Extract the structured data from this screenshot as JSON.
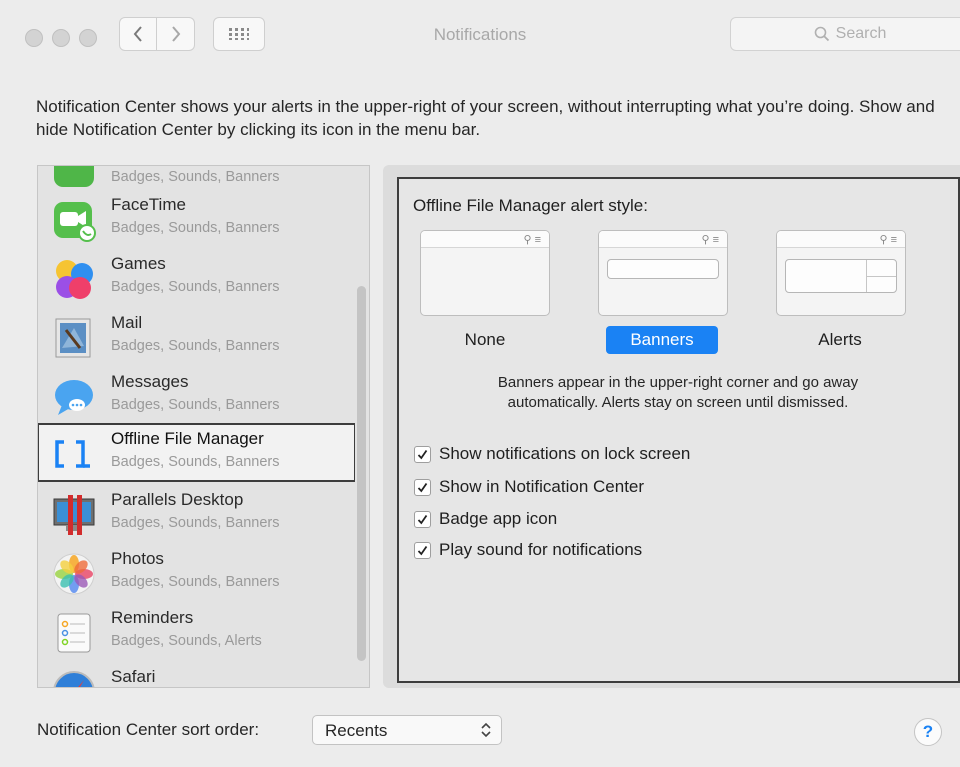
{
  "window": {
    "title": "Notifications"
  },
  "search": {
    "placeholder": "Search"
  },
  "intro": "Notification Center shows your alerts in the upper-right of your screen, without interrupting what you’re doing. Show and hide Notification Center by clicking its icon in the menu bar.",
  "app_list": [
    {
      "name": "",
      "status": "Badges, Sounds, Banners",
      "icon": "facetime-partial-icon"
    },
    {
      "name": "FaceTime",
      "status": "Badges, Sounds, Banners",
      "icon": "facetime-icon"
    },
    {
      "name": "Games",
      "status": "Badges, Sounds, Banners",
      "icon": "game-center-icon"
    },
    {
      "name": "Mail",
      "status": "Badges, Sounds, Banners",
      "icon": "mail-icon"
    },
    {
      "name": "Messages",
      "status": "Badges, Sounds, Banners",
      "icon": "messages-icon"
    },
    {
      "name": "Offline File Manager",
      "status": "Badges, Sounds, Banners",
      "icon": "offline-file-manager-icon",
      "selected": true
    },
    {
      "name": "Parallels Desktop",
      "status": "Badges, Sounds, Banners",
      "icon": "parallels-icon"
    },
    {
      "name": "Photos",
      "status": "Badges, Sounds, Banners",
      "icon": "photos-icon"
    },
    {
      "name": "Reminders",
      "status": "Badges, Sounds, Alerts",
      "icon": "reminders-icon"
    },
    {
      "name": "Safari",
      "status": "",
      "icon": "safari-icon"
    }
  ],
  "detail": {
    "alert_style_title": "Offline File Manager alert style:",
    "styles": [
      {
        "label": "None",
        "selected": false
      },
      {
        "label": "Banners",
        "selected": true
      },
      {
        "label": "Alerts",
        "selected": false
      }
    ],
    "description_line1": "Banners appear in the upper-right corner and go away",
    "description_line2": "automatically. Alerts stay on screen until dismissed.",
    "options": [
      {
        "label": "Show notifications on lock screen",
        "checked": true
      },
      {
        "label": "Show in Notification Center",
        "checked": true
      },
      {
        "label": "Badge app icon",
        "checked": true
      },
      {
        "label": "Play sound for notifications",
        "checked": true
      }
    ]
  },
  "footer": {
    "sort_label": "Notification Center sort order:",
    "sort_value": "Recents",
    "help_label": "?"
  },
  "colors": {
    "accent": "#1a82f4",
    "selection_border": "#3d3d3d",
    "background": "#ececec"
  }
}
